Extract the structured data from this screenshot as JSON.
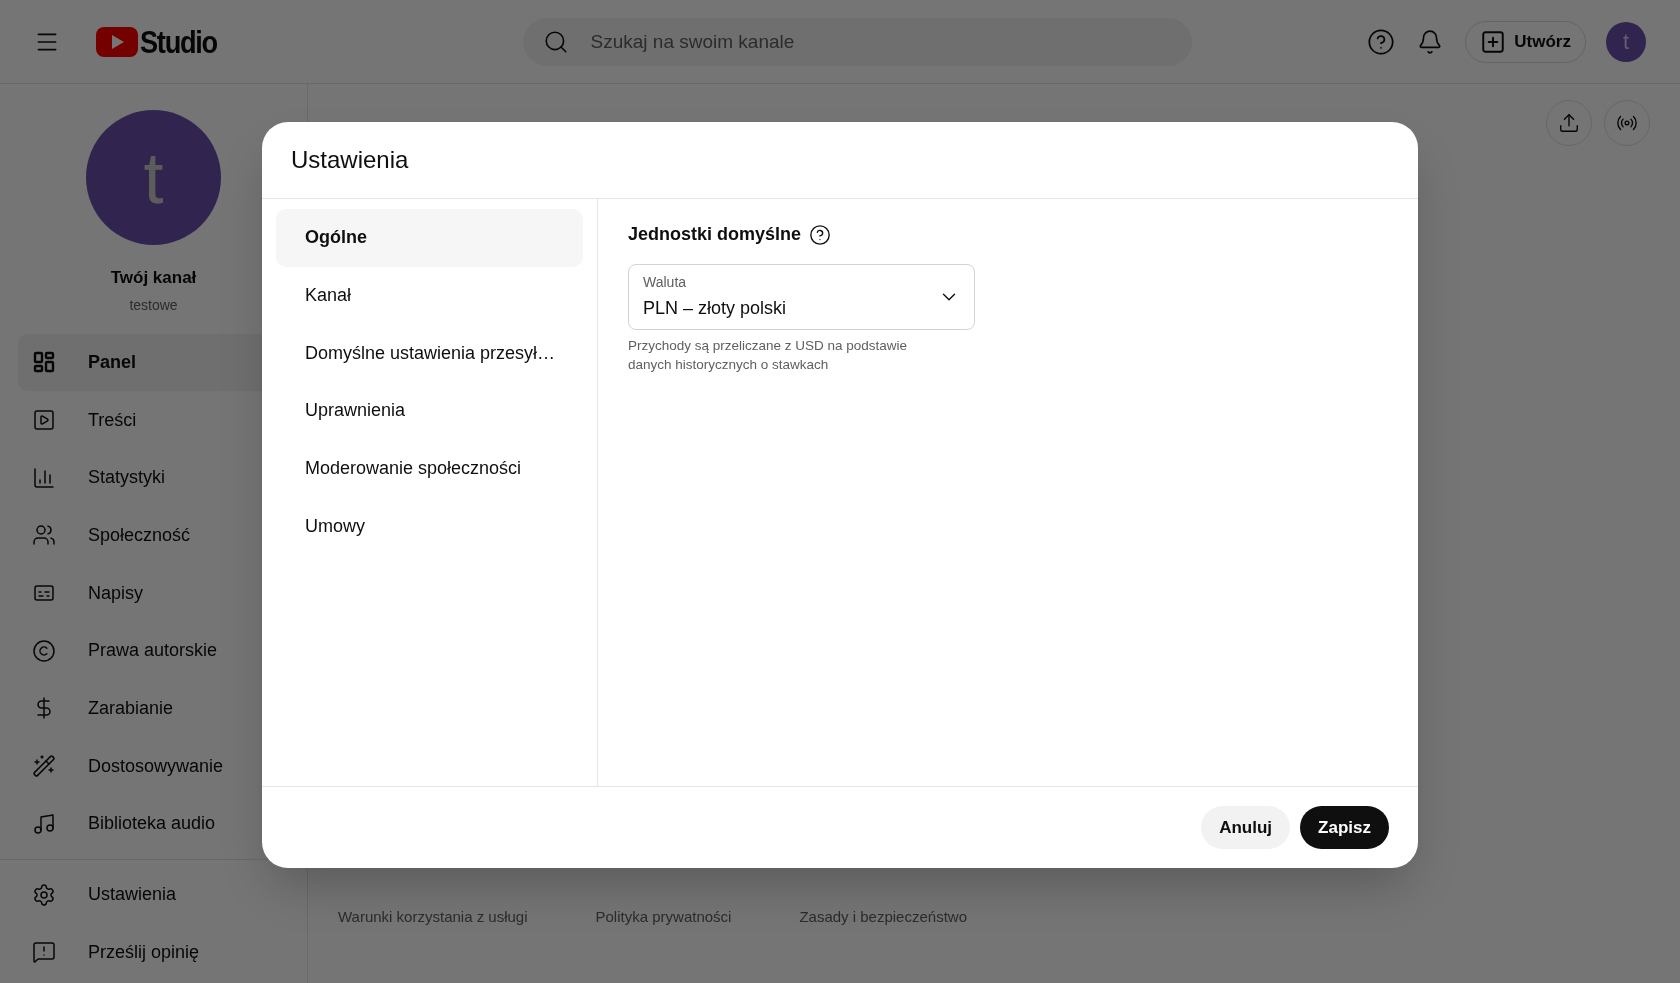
{
  "top_bar": {
    "logo_text": "Studio",
    "search": {
      "placeholder": "Szukaj na swoim kanale"
    },
    "create_button": "Utwórz",
    "avatar_letter": "t"
  },
  "sidebar": {
    "channel": {
      "avatar_letter": "t",
      "name": "Twój kanał",
      "handle": "testowe"
    },
    "items": [
      {
        "label": "Panel",
        "selected": true
      },
      {
        "label": "Treści",
        "selected": false
      },
      {
        "label": "Statystyki",
        "selected": false
      },
      {
        "label": "Społeczność",
        "selected": false
      },
      {
        "label": "Napisy",
        "selected": false
      },
      {
        "label": "Prawa autorskie",
        "selected": false
      },
      {
        "label": "Zarabianie",
        "selected": false
      },
      {
        "label": "Dostosowywanie",
        "selected": false
      },
      {
        "label": "Biblioteka audio",
        "selected": false
      }
    ],
    "bottom_items": [
      {
        "label": "Ustawienia"
      },
      {
        "label": "Prześlij opinię"
      }
    ]
  },
  "footer_links": [
    "Warunki korzystania z usługi",
    "Polityka prywatności",
    "Zasady i bezpieczeństwo"
  ],
  "dialog": {
    "title": "Ustawienia",
    "nav": [
      {
        "label": "Ogólne",
        "selected": true
      },
      {
        "label": "Kanał",
        "selected": false
      },
      {
        "label": "Domyślne ustawienia przesył…",
        "selected": false
      },
      {
        "label": "Uprawnienia",
        "selected": false
      },
      {
        "label": "Moderowanie społeczności",
        "selected": false
      },
      {
        "label": "Umowy",
        "selected": false
      }
    ],
    "section": {
      "title": "Jednostki domyślne",
      "select": {
        "label": "Waluta",
        "value": "PLN – złoty polski"
      },
      "helper": "Przychody są przeliczane z USD na podstawie danych historycznych o stawkach"
    },
    "buttons": {
      "cancel": "Anuluj",
      "save": "Zapisz"
    }
  }
}
